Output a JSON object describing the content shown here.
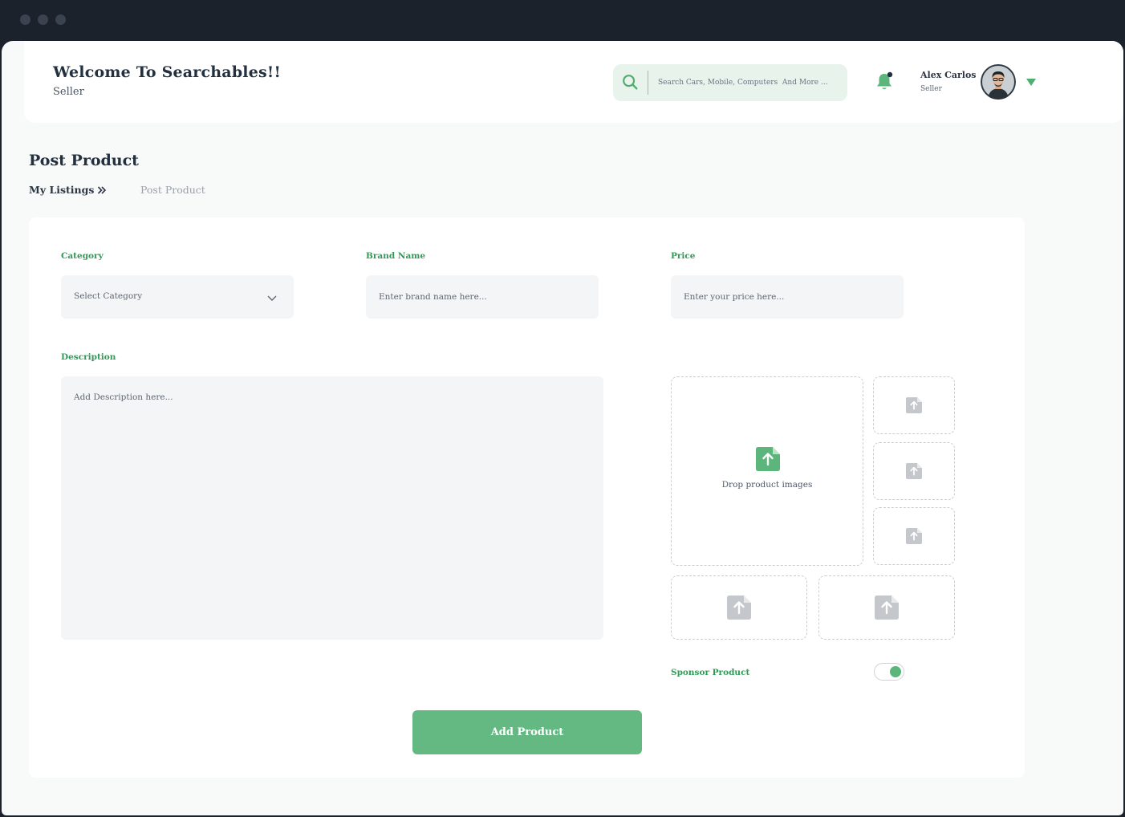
{
  "colors": {
    "accent": "#64b983",
    "accent_text": "#2e9a55",
    "frame": "#1b222c",
    "field_bg": "#f4f5f6"
  },
  "header": {
    "welcome": "Welcome To Searchables!!",
    "role": "Seller",
    "search_placeholder": "Search Cars, Mobile, Computers  And More ...",
    "user": {
      "name": "Alex Carlos",
      "role": "Seller"
    }
  },
  "page": {
    "title": "Post Product",
    "breadcrumb": [
      "My Listings",
      "Post Product"
    ]
  },
  "form": {
    "category": {
      "label": "Category",
      "value": "Select Category"
    },
    "brand": {
      "label": "Brand Name",
      "placeholder": "Enter brand name here..."
    },
    "price": {
      "label": "Price",
      "placeholder": "Enter your price here..."
    },
    "description": {
      "label": "Description",
      "placeholder": "Add Description here..."
    },
    "images": {
      "drop_text": "Drop product images"
    },
    "sponsor": {
      "label": "Sponsor Product",
      "enabled": true
    },
    "submit_label": "Add Product"
  }
}
